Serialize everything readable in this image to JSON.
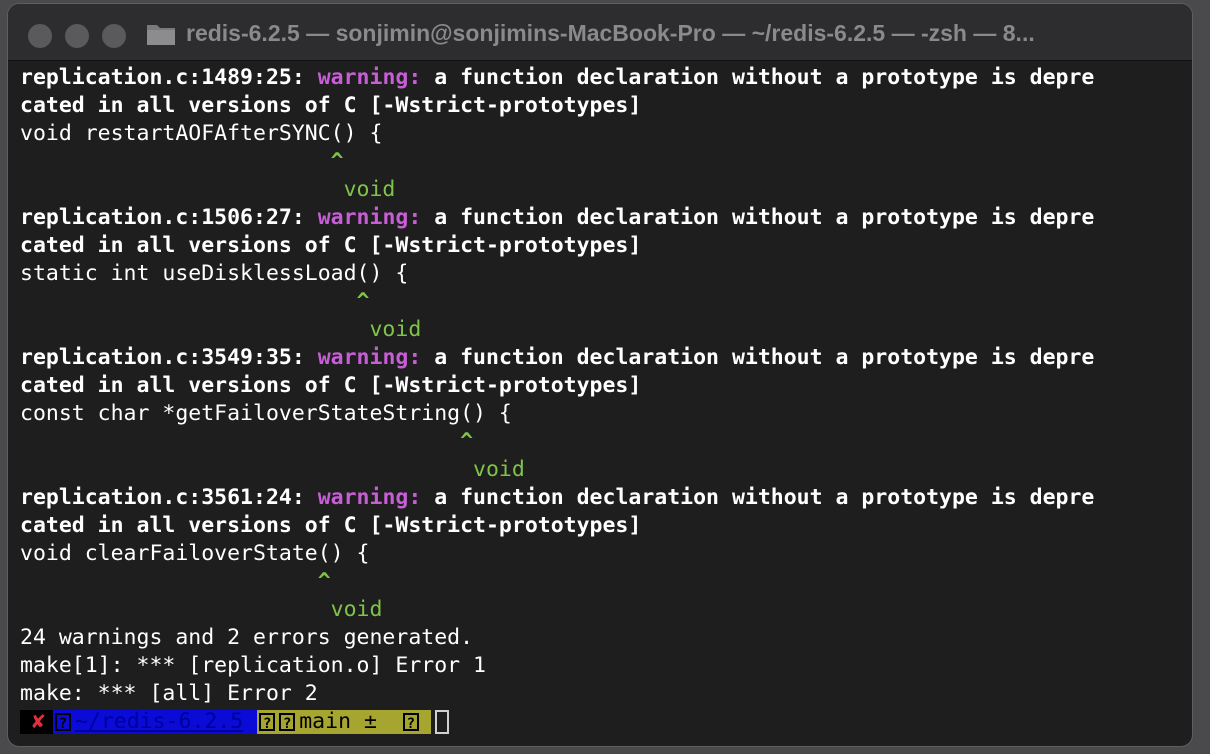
{
  "window": {
    "title": "redis-6.2.5 — sonjimin@sonjimins-MacBook-Pro — ~/redis-6.2.5 — -zsh — 8..."
  },
  "colors": {
    "warning": "#c75ed6",
    "hint": "#7fc447",
    "path_segment": "#0b0bd8",
    "git_segment": "#a5a530",
    "error_mark": "#e0303a"
  },
  "output": {
    "w1": {
      "loc": "replication.c:1489:25: ",
      "label": "warning:",
      "msg": " a function declaration without a prototype is depre",
      "cont": "cated in all versions of C [-Wstrict-prototypes]",
      "code": "void restartAOFAfterSYNC() {",
      "caret": "                        ^",
      "fix": "                         void"
    },
    "w2": {
      "loc": "replication.c:1506:27: ",
      "label": "warning:",
      "msg": " a function declaration without a prototype is depre",
      "cont": "cated in all versions of C [-Wstrict-prototypes]",
      "code": "static int useDisklessLoad() {",
      "caret": "                          ^",
      "fix": "                           void"
    },
    "w3": {
      "loc": "replication.c:3549:35: ",
      "label": "warning:",
      "msg": " a function declaration without a prototype is depre",
      "cont": "cated in all versions of C [-Wstrict-prototypes]",
      "code": "const char *getFailoverStateString() {",
      "caret": "                                  ^",
      "fix": "                                   void"
    },
    "w4": {
      "loc": "replication.c:3561:24: ",
      "label": "warning:",
      "msg": " a function declaration without a prototype is depre",
      "cont": "cated in all versions of C [-Wstrict-prototypes]",
      "code": "void clearFailoverState() {",
      "caret": "                       ^",
      "fix": "                        void"
    },
    "summary": "24 warnings and 2 errors generated.",
    "make1": "make[1]: *** [replication.o] Error 1",
    "make2": "make: *** [all] Error 2"
  },
  "prompt": {
    "status_mark": "✘",
    "glyph": "?",
    "path": "~/redis-6.2.5",
    "branch": "main ±"
  }
}
